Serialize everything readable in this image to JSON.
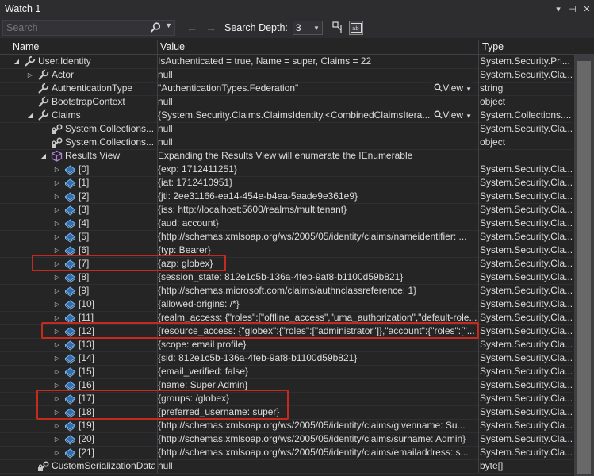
{
  "window": {
    "title": "Watch 1",
    "buttons": [
      "▾",
      "⊣",
      "✕"
    ]
  },
  "toolbar": {
    "search_placeholder": "Search",
    "back": "←",
    "forward": "→",
    "depth_label": "Search Depth:",
    "depth_value": "3"
  },
  "columns": {
    "name": "Name",
    "value": "Value",
    "type": "Type"
  },
  "rows": [
    {
      "level": 0,
      "exp": "expanded",
      "icon": "wrench",
      "name": "User.Identity",
      "value": "IsAuthenticated = true, Name = super, Claims = 22",
      "type": "System.Security.Pri..."
    },
    {
      "level": 1,
      "exp": "collapsed",
      "icon": "wrench",
      "name": "Actor",
      "value": "null",
      "type": "System.Security.Cla..."
    },
    {
      "level": 1,
      "exp": "none",
      "icon": "wrench",
      "name": "AuthenticationType",
      "value": "\"AuthenticationTypes.Federation\"",
      "type": "string",
      "view": "View"
    },
    {
      "level": 1,
      "exp": "none",
      "icon": "wrench",
      "name": "BootstrapContext",
      "value": "null",
      "type": "object"
    },
    {
      "level": 1,
      "exp": "expanded",
      "icon": "wrench",
      "name": "Claims",
      "value": "{System.Security.Claims.ClaimsIdentity.<CombinedClaimsItera...",
      "type": "System.Collections....",
      "view": "View"
    },
    {
      "level": 2,
      "exp": "none",
      "icon": "lockwrench",
      "name": "System.Collections....",
      "value": "null",
      "type": "System.Security.Cla..."
    },
    {
      "level": 2,
      "exp": "none",
      "icon": "lockwrench",
      "name": "System.Collections....",
      "value": "null",
      "type": "object"
    },
    {
      "level": 2,
      "exp": "expanded",
      "icon": "cube",
      "name": "Results View",
      "value": "Expanding the Results View will enumerate the IEnumerable",
      "type": ""
    },
    {
      "level": 3,
      "exp": "collapsed",
      "icon": "field",
      "name": "[0]",
      "value": "{exp: 1712411251}",
      "type": "System.Security.Cla..."
    },
    {
      "level": 3,
      "exp": "collapsed",
      "icon": "field",
      "name": "[1]",
      "value": "{iat: 1712410951}",
      "type": "System.Security.Cla..."
    },
    {
      "level": 3,
      "exp": "collapsed",
      "icon": "field",
      "name": "[2]",
      "value": "{jti: 2ee31166-ea14-454e-b4ea-5aade9e361e9}",
      "type": "System.Security.Cla..."
    },
    {
      "level": 3,
      "exp": "collapsed",
      "icon": "field",
      "name": "[3]",
      "value": "{iss: http://localhost:5600/realms/multitenant}",
      "type": "System.Security.Cla..."
    },
    {
      "level": 3,
      "exp": "collapsed",
      "icon": "field",
      "name": "[4]",
      "value": "{aud: account}",
      "type": "System.Security.Cla..."
    },
    {
      "level": 3,
      "exp": "collapsed",
      "icon": "field",
      "name": "[5]",
      "value": "{http://schemas.xmlsoap.org/ws/2005/05/identity/claims/nameidentifier: ...",
      "type": "System.Security.Cla..."
    },
    {
      "level": 3,
      "exp": "collapsed",
      "icon": "field",
      "name": "[6]",
      "value": "{typ: Bearer}",
      "type": "System.Security.Cla..."
    },
    {
      "level": 3,
      "exp": "collapsed",
      "icon": "field",
      "name": "[7]",
      "value": "{azp: globex}",
      "type": "System.Security.Cla..."
    },
    {
      "level": 3,
      "exp": "collapsed",
      "icon": "field",
      "name": "[8]",
      "value": "{session_state: 812e1c5b-136a-4feb-9af8-b1100d59b821}",
      "type": "System.Security.Cla..."
    },
    {
      "level": 3,
      "exp": "collapsed",
      "icon": "field",
      "name": "[9]",
      "value": "{http://schemas.microsoft.com/claims/authnclassreference: 1}",
      "type": "System.Security.Cla..."
    },
    {
      "level": 3,
      "exp": "collapsed",
      "icon": "field",
      "name": "[10]",
      "value": "{allowed-origins: /*}",
      "type": "System.Security.Cla..."
    },
    {
      "level": 3,
      "exp": "collapsed",
      "icon": "field",
      "name": "[11]",
      "value": "{realm_access: {\"roles\":[\"offline_access\",\"uma_authorization\",\"default-role...",
      "type": "System.Security.Cla..."
    },
    {
      "level": 3,
      "exp": "collapsed",
      "icon": "field",
      "name": "[12]",
      "value": "{resource_access: {\"globex\":{\"roles\":[\"administrator\"]},\"account\":{\"roles\":[\"...",
      "type": "System.Security.Cla..."
    },
    {
      "level": 3,
      "exp": "collapsed",
      "icon": "field",
      "name": "[13]",
      "value": "{scope: email profile}",
      "type": "System.Security.Cla..."
    },
    {
      "level": 3,
      "exp": "collapsed",
      "icon": "field",
      "name": "[14]",
      "value": "{sid: 812e1c5b-136a-4feb-9af8-b1100d59b821}",
      "type": "System.Security.Cla..."
    },
    {
      "level": 3,
      "exp": "collapsed",
      "icon": "field",
      "name": "[15]",
      "value": "{email_verified: false}",
      "type": "System.Security.Cla..."
    },
    {
      "level": 3,
      "exp": "collapsed",
      "icon": "field",
      "name": "[16]",
      "value": "{name: Super Admin}",
      "type": "System.Security.Cla..."
    },
    {
      "level": 3,
      "exp": "collapsed",
      "icon": "field",
      "name": "[17]",
      "value": "{groups: /globex}",
      "type": "System.Security.Cla..."
    },
    {
      "level": 3,
      "exp": "collapsed",
      "icon": "field",
      "name": "[18]",
      "value": "{preferred_username: super}",
      "type": "System.Security.Cla..."
    },
    {
      "level": 3,
      "exp": "collapsed",
      "icon": "field",
      "name": "[19]",
      "value": "{http://schemas.xmlsoap.org/ws/2005/05/identity/claims/givenname: Su...",
      "type": "System.Security.Cla..."
    },
    {
      "level": 3,
      "exp": "collapsed",
      "icon": "field",
      "name": "[20]",
      "value": "{http://schemas.xmlsoap.org/ws/2005/05/identity/claims/surname: Admin}",
      "type": "System.Security.Cla..."
    },
    {
      "level": 3,
      "exp": "collapsed",
      "icon": "field",
      "name": "[21]",
      "value": "{http://schemas.xmlsoap.org/ws/2005/05/identity/claims/emailaddress: s...",
      "type": "System.Security.Cla..."
    },
    {
      "level": 1,
      "exp": "none",
      "icon": "lockwrench",
      "name": "CustomSerializationData",
      "value": "null",
      "type": "byte[]"
    }
  ],
  "highlights": [
    {
      "from_row": "[7]",
      "to_row": "[7]"
    },
    {
      "from_row": "[12]",
      "to_row": "[12]"
    },
    {
      "from_row": "[17]",
      "to_row": "[18]"
    }
  ],
  "colors": {
    "background": "#252526",
    "text": "#dcdcdc",
    "highlight": "#c42b1c",
    "icon_blue": "#5b9bd5",
    "icon_purple": "#b180d7"
  }
}
